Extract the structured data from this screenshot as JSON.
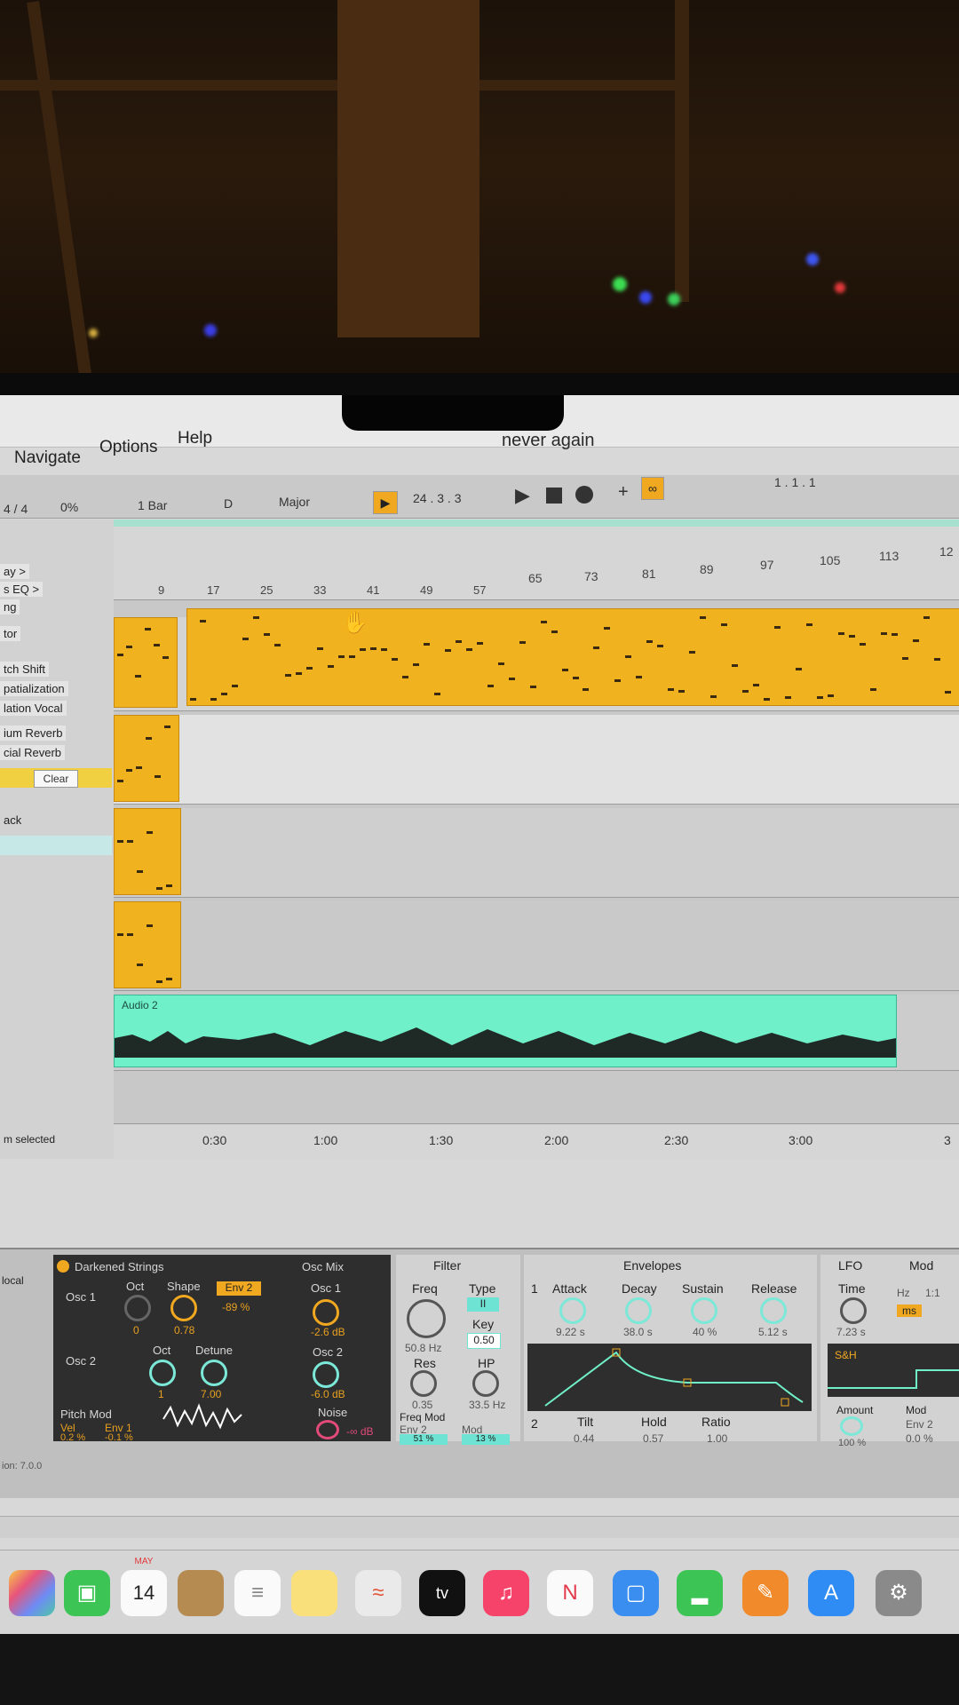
{
  "menu": {
    "items": [
      "Navigate",
      "Options",
      "Help"
    ]
  },
  "song": {
    "title": "never again"
  },
  "controls": {
    "time_sig": "4 / 4",
    "cpu": "0%",
    "quantize": "1 Bar",
    "key": "D",
    "scale": "Major",
    "position": "24 .  3 .  3",
    "loop_start": "1 .  1 .  1"
  },
  "ruler": {
    "bars_top": [
      "9",
      "17",
      "25",
      "33",
      "41",
      "49",
      "57",
      "65",
      "73",
      "81",
      "89",
      "97",
      "105",
      "113",
      "12"
    ],
    "times": [
      "0:30",
      "1:00",
      "1:30",
      "2:00",
      "2:30",
      "3:00",
      "3"
    ]
  },
  "left_panel": {
    "items": [
      "ay >",
      "s  EQ >",
      "ng",
      "tor",
      "tch Shift",
      "patialization",
      "lation  Vocal",
      "ium Reverb",
      "cial Reverb",
      "ack",
      "m selected"
    ],
    "clear_label": "Clear"
  },
  "tracks": {
    "audio_label": "Audio 2"
  },
  "device": {
    "name": "Darkened Strings",
    "sections": [
      "Osc Mix",
      "Filter",
      "Envelopes",
      "LFO",
      "Mod"
    ],
    "osc1": {
      "label": "Osc 1",
      "oct_label": "Oct",
      "oct_value": "0",
      "shape_label": "Shape",
      "shape_value": "0.78",
      "env_label": "Env 2",
      "env_value": "-89 %"
    },
    "osc2": {
      "label": "Osc 2",
      "oct_label": "Oct",
      "oct_value": "1",
      "detune_label": "Detune",
      "detune_value": "7.00"
    },
    "pitch_mod": {
      "label": "Pitch Mod",
      "vel": "Vel",
      "env": "Env 1",
      "val1": "0.2 %",
      "val2": "-0.1 %"
    },
    "osc_mix": {
      "osc1_label": "Osc 1",
      "osc1_value": "-2.6 dB",
      "osc2_label": "Osc 2",
      "osc2_value": "-6.0 dB",
      "noise_label": "Noise",
      "noise_value": "-∞ dB"
    },
    "filter": {
      "freq_label": "Freq",
      "freq_value": "50.8 Hz",
      "type_label": "Type",
      "key_label": "Key",
      "key_value": "0.50",
      "res_label": "Res",
      "res_value": "0.35",
      "hp_label": "HP",
      "hp_value": "33.5 Hz",
      "freq_mod_label": "Freq Mod",
      "mod1": "Env 2",
      "mod2": "Mod",
      "mod1_value": "51 %",
      "mod2_value": "13 %"
    },
    "envelopes": {
      "env1_num": "1",
      "attack_label": "Attack",
      "attack_value": "9.22 s",
      "decay_label": "Decay",
      "decay_value": "38.0 s",
      "sustain_label": "Sustain",
      "sustain_value": "40 %",
      "release_label": "Release",
      "release_value": "5.12 s",
      "env2_num": "2",
      "tilt_label": "Tilt",
      "tilt_value": "0.44",
      "hold_label": "Hold",
      "hold_value": "0.57",
      "ratio_label": "Ratio",
      "ratio_value": "1.00"
    },
    "lfo": {
      "time_label": "Time",
      "time_value": "7.23 s",
      "hz": "Hz",
      "ratio": "1:1",
      "ms": "ms",
      "shape": "S&H",
      "amount_label": "Amount",
      "amount_value": "100 %",
      "mod_label": "Mod",
      "mod_env": "Env 2",
      "mod_value": "0.0 %"
    },
    "local_label": "local",
    "version": "ion: 7.0.0"
  },
  "dock": {
    "calendar_month": "MAY",
    "calendar_day": "14",
    "tv_label": "tv"
  },
  "colors": {
    "clip": "#f0b21e",
    "audio": "#6ff0c8",
    "accent": "#f0a820"
  }
}
